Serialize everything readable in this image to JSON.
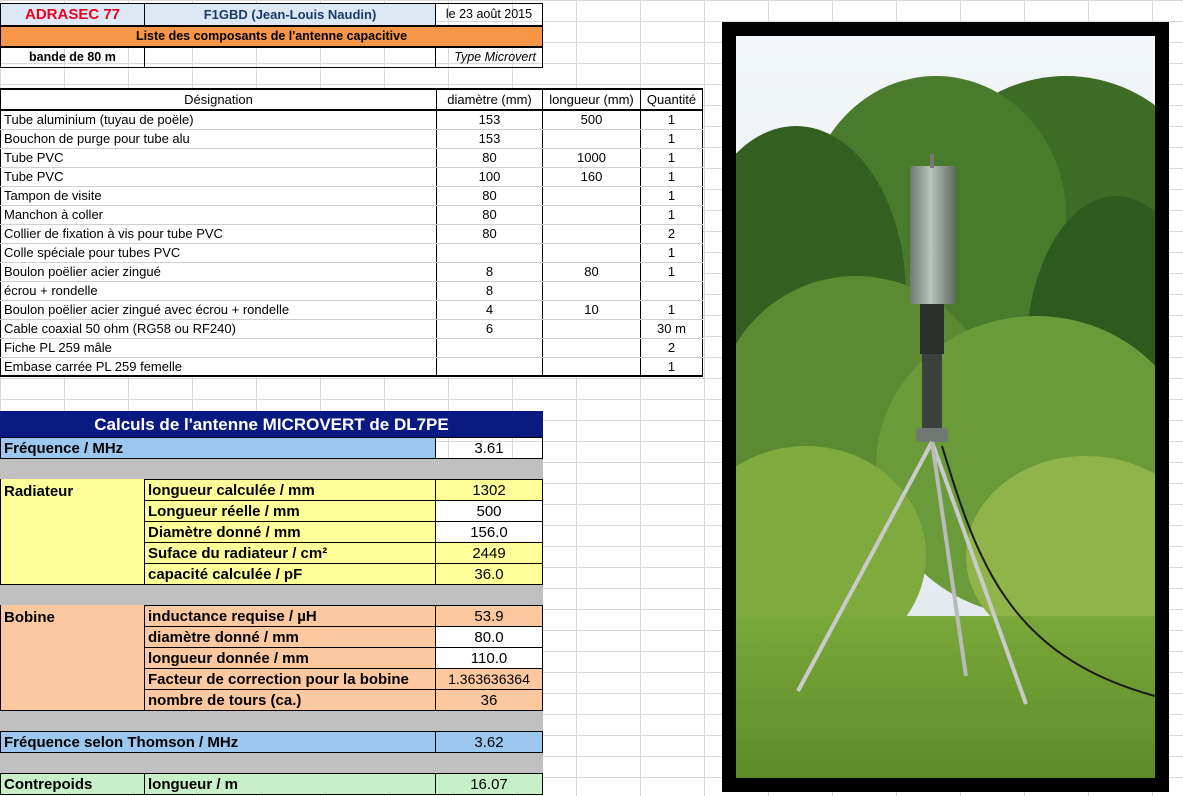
{
  "header": {
    "org": "ADRASEC 77",
    "author": "F1GBD (Jean-Louis Naudin)",
    "date": "le 23 août 2015",
    "list_title": "Liste des composants de l'antenne capacitive",
    "band": "bande de 80 m",
    "type": "Type Microvert"
  },
  "parts": {
    "columns": [
      "Désignation",
      "diamètre (mm)",
      "longueur (mm)",
      "Quantité"
    ],
    "rows": [
      {
        "designation": "Tube aluminium (tuyau de poële)",
        "diametre": "153",
        "longueur": "500",
        "quantite": "1"
      },
      {
        "designation": "Bouchon de purge pour tube alu",
        "diametre": "153",
        "longueur": "",
        "quantite": "1"
      },
      {
        "designation": "Tube PVC",
        "diametre": "80",
        "longueur": "1000",
        "quantite": "1"
      },
      {
        "designation": "Tube PVC",
        "diametre": "100",
        "longueur": "160",
        "quantite": "1"
      },
      {
        "designation": "Tampon de visite",
        "diametre": "80",
        "longueur": "",
        "quantite": "1"
      },
      {
        "designation": "Manchon à coller",
        "diametre": "80",
        "longueur": "",
        "quantite": "1"
      },
      {
        "designation": "Collier de fixation à vis pour tube PVC",
        "diametre": "80",
        "longueur": "",
        "quantite": "2"
      },
      {
        "designation": "Colle spéciale pour tubes PVC",
        "diametre": "",
        "longueur": "",
        "quantite": "1"
      },
      {
        "designation": "Boulon poëlier acier zingué",
        "diametre": "8",
        "longueur": "80",
        "quantite": "1"
      },
      {
        "designation": "écrou + rondelle",
        "diametre": "8",
        "longueur": "",
        "quantite": ""
      },
      {
        "designation": "Boulon poëlier acier zingué avec écrou + rondelle",
        "diametre": "4",
        "longueur": "10",
        "quantite": "1"
      },
      {
        "designation": "Cable coaxial 50 ohm (RG58 ou RF240)",
        "diametre": "6",
        "longueur": "",
        "quantite": "30 m"
      },
      {
        "designation": "Fiche PL 259 mâle",
        "diametre": "",
        "longueur": "",
        "quantite": "2"
      },
      {
        "designation": "Embase carrée PL 259 femelle",
        "diametre": "",
        "longueur": "",
        "quantite": "1"
      }
    ]
  },
  "calc": {
    "title": "Calculs de l'antenne MICROVERT de DL7PE",
    "frequence_label": "Fréquence / MHz",
    "frequence_value": "3.61",
    "radiateur": {
      "label": "Radiateur",
      "rows": [
        {
          "label": "longueur calculée / mm",
          "value": "1302"
        },
        {
          "label": "Longueur réelle / mm",
          "value": "500"
        },
        {
          "label": "Diamètre donné / mm",
          "value": "156.0"
        },
        {
          "label": "Suface du radiateur / cm²",
          "value": "2449"
        },
        {
          "label": "capacité calculée / pF",
          "value": "36.0"
        }
      ]
    },
    "bobine": {
      "label": "Bobine",
      "rows": [
        {
          "label": "inductance requise / µH",
          "value": "53.9"
        },
        {
          "label": "diamètre donné / mm",
          "value": "80.0"
        },
        {
          "label": "longueur donnée / mm",
          "value": "110.0"
        },
        {
          "label": "Facteur de correction pour la bobine",
          "value": "1.363636364"
        },
        {
          "label": "nombre de tours (ca.)",
          "value": "36"
        }
      ]
    },
    "thomson_label": "Fréquence selon Thomson / MHz",
    "thomson_value": "3.62",
    "contrepoids": {
      "label": "Contrepoids",
      "sub": "longueur / m",
      "value": "16.07"
    }
  },
  "colors": {
    "org_text": "#e8001c",
    "header_bg": "#dce9f5",
    "orange_bar": "#f79646",
    "navy": "#0a1a80",
    "blue": "#9cc8f0",
    "yellow": "#ffff99",
    "orange": "#fbc8a0",
    "green": "#c8f0c8"
  }
}
